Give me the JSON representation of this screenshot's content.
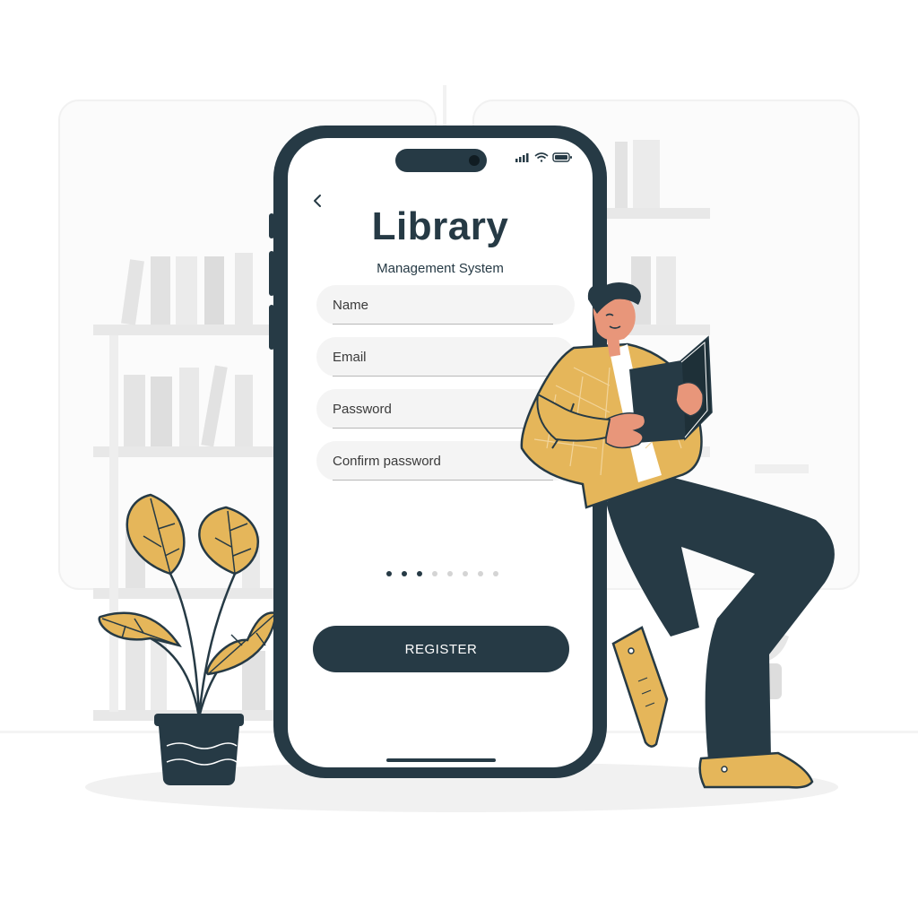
{
  "app": {
    "title": "Library",
    "subtitle": "Management System"
  },
  "form": {
    "fields": [
      {
        "placeholder": "Name",
        "value": ""
      },
      {
        "placeholder": "Email",
        "value": ""
      },
      {
        "placeholder": "Password",
        "value": ""
      },
      {
        "placeholder": "Confirm password",
        "value": ""
      }
    ],
    "register_label": "REGISTER"
  },
  "pager": {
    "total": 8,
    "filled": 3
  },
  "icons": {
    "back": "chevron-left-icon",
    "signal": "signal-icon",
    "wifi": "wifi-icon",
    "battery": "battery-icon"
  },
  "colors": {
    "primary": "#263A45",
    "accent": "#E5B65A",
    "field_bg": "#F4F4F4",
    "skin": "#E8967A",
    "background_shelf": "#ECECEC"
  }
}
